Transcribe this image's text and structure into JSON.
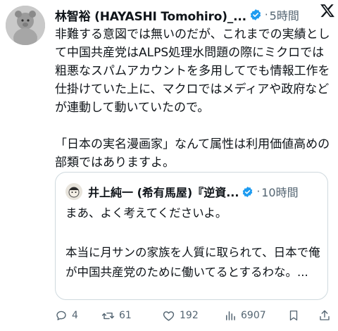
{
  "author": {
    "name": "林智裕 (HAYASHI Tomohiro)_...",
    "separator": "·",
    "time": "5時間"
  },
  "tweet": {
    "text": "非難する意図では無いのだが、これまでの実績として中国共産党はALPS処理水問題の際にミクロでは粗悪なスパムアカウントを多用してでも情報工作を仕掛けていた上に、マクロではメディアや政府などが連動して動いていたので。\n\n「日本の実名漫画家」なんて属性は利用価値高めの部類ではありますよ。"
  },
  "quoted": {
    "name": "井上純一 (希有馬屋)『逆資...",
    "separator": "·",
    "time": "10時間",
    "text": "まあ、よく考えてくださいよ。\n\n本当に月サンの家族を人質に取られて、日本で俺が中国共産党のために働いてるとするわな。..."
  },
  "actions": {
    "replies": "4",
    "reposts": "61",
    "likes": "192",
    "views": "6907"
  },
  "colors": {
    "verified": "#1d9bf0",
    "secondary_text": "#536471",
    "border": "#cfd9de"
  },
  "icons": [
    "x-logo-icon",
    "verified-badge-icon",
    "reply-icon",
    "repost-icon",
    "like-icon",
    "views-icon",
    "bookmark-icon",
    "share-icon"
  ]
}
